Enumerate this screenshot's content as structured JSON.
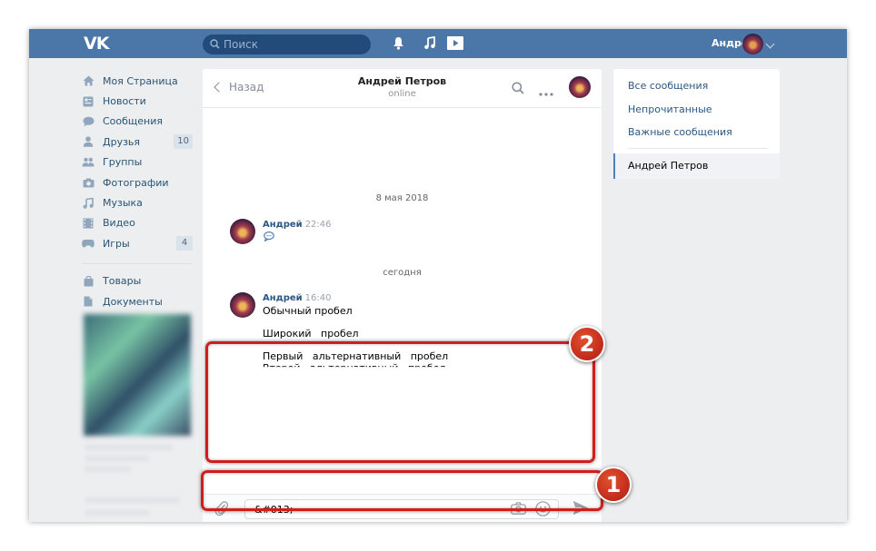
{
  "header": {
    "logo": "VK",
    "search_placeholder": "Поиск",
    "user_name": "Андрей",
    "icons": [
      "search-icon",
      "bell-icon",
      "music-icon",
      "video-play-icon",
      "chevron-down-icon"
    ],
    "color": "#4a76a8"
  },
  "sidebar": {
    "items": [
      {
        "label": "Моя Страница",
        "icon": "home-icon"
      },
      {
        "label": "Новости",
        "icon": "news-icon"
      },
      {
        "label": "Сообщения",
        "icon": "messages-icon"
      },
      {
        "label": "Друзья",
        "icon": "friends-icon",
        "count": "10"
      },
      {
        "label": "Группы",
        "icon": "groups-icon"
      },
      {
        "label": "Фотографии",
        "icon": "camera-icon"
      },
      {
        "label": "Музыка",
        "icon": "music-icon"
      },
      {
        "label": "Видео",
        "icon": "video-icon"
      },
      {
        "label": "Игры",
        "icon": "gamepad-icon",
        "count": "4"
      }
    ],
    "extra_items": [
      {
        "label": "Товары",
        "icon": "bag-icon"
      },
      {
        "label": "Документы",
        "icon": "document-icon"
      }
    ]
  },
  "chat": {
    "back_label": "Назад",
    "peer_name": "Андрей Петров",
    "peer_status": "online",
    "groups": [
      {
        "date": "8 мая 2018",
        "messages": [
          {
            "author": "Андрей",
            "time": "22:46",
            "body": ""
          }
        ]
      },
      {
        "date": "сегодня",
        "messages": [
          {
            "author": "Андрей",
            "time": "16:40",
            "lines": [
              "Обычный пробел",
              "Широкий   пробел",
              "Первый   альтернативный   пробел",
              "Второй   альтернативный   пробел"
            ]
          }
        ]
      }
    ],
    "input_value": "&#013;"
  },
  "rightpanel": {
    "items": [
      "Все сообщения",
      "Непрочитанные",
      "Важные сообщения"
    ],
    "active": "Андрей Петров"
  },
  "annotations": {
    "badge_1": "1",
    "badge_2": "2",
    "color": "#d21d1d"
  }
}
